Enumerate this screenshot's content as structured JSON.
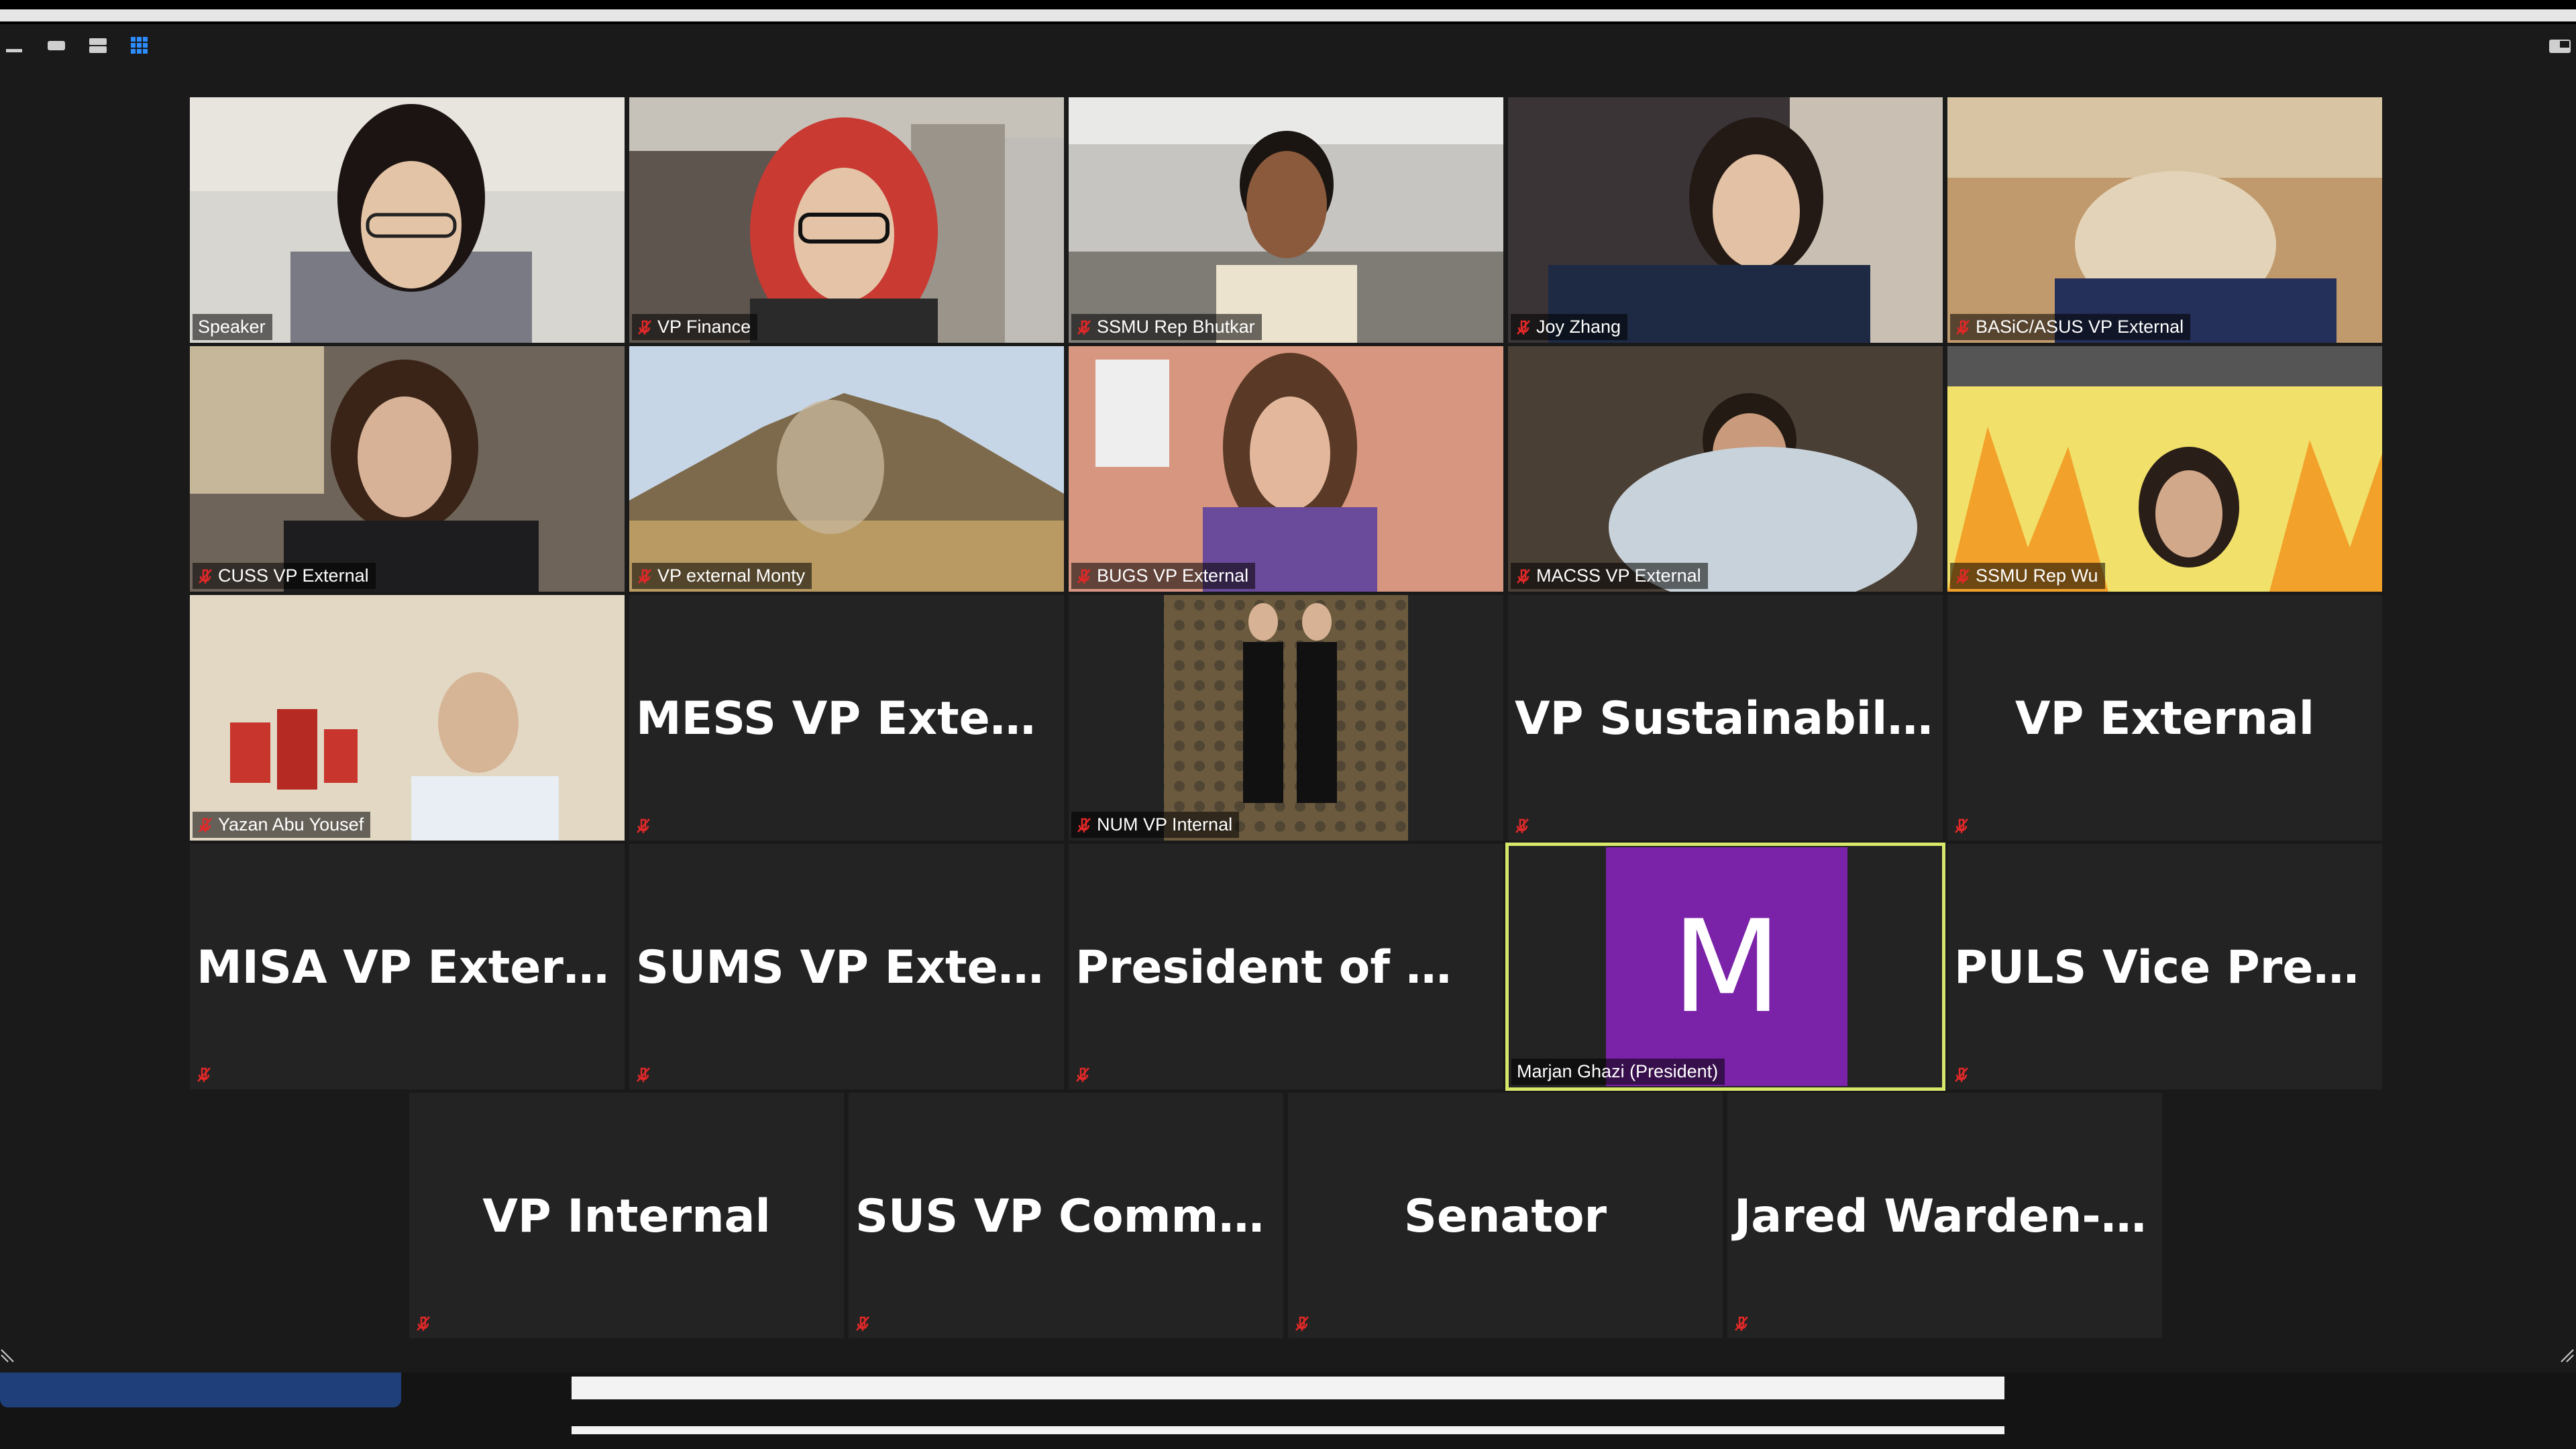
{
  "colors": {
    "accent_active": "#d7e86a",
    "tile_bg": "#232323",
    "avatar_bg": "#7a22a8",
    "mute_red": "#e02828"
  },
  "toolbar": {
    "minimize_icon": "minimize-icon",
    "speaker_view_icon": "speaker-view-icon",
    "strip_view_icon": "strip-view-icon",
    "gallery_view_icon": "gallery-view-icon",
    "exit_fullscreen_icon": "exit-fullscreen-icon"
  },
  "participants": [
    {
      "label": "Speaker",
      "muted": false,
      "type": "video"
    },
    {
      "label": "VP Finance",
      "muted": true,
      "type": "video"
    },
    {
      "label": "SSMU Rep Bhutkar",
      "muted": true,
      "type": "video"
    },
    {
      "label": "Joy Zhang",
      "muted": true,
      "type": "video"
    },
    {
      "label": "BASiC/ASUS VP External",
      "muted": true,
      "type": "video"
    },
    {
      "label": "CUSS VP External",
      "muted": true,
      "type": "video"
    },
    {
      "label": "VP external Monty",
      "muted": true,
      "type": "video"
    },
    {
      "label": "BUGS VP External",
      "muted": true,
      "type": "video"
    },
    {
      "label": "MACSS VP External",
      "muted": true,
      "type": "video"
    },
    {
      "label": "SSMU Rep Wu",
      "muted": true,
      "type": "video"
    },
    {
      "label": "Yazan Abu Yousef",
      "muted": true,
      "type": "video"
    },
    {
      "name": "MESS VP External",
      "muted": true,
      "type": "name"
    },
    {
      "label": "NUM VP Internal",
      "muted": true,
      "type": "photo"
    },
    {
      "name": "VP Sustainability",
      "muted": true,
      "type": "name"
    },
    {
      "name": "VP External",
      "muted": true,
      "type": "name"
    },
    {
      "name": "MISA VP External",
      "muted": true,
      "type": "name"
    },
    {
      "name": "SUMS VP External",
      "muted": true,
      "type": "name"
    },
    {
      "name": "President of Mo...",
      "muted": true,
      "type": "name"
    },
    {
      "label": "Marjan Ghazi (President)",
      "avatar_letter": "M",
      "muted": false,
      "type": "avatar",
      "active": true
    },
    {
      "name": "PULS Vice Presid...",
      "muted": true,
      "type": "name"
    },
    {
      "name": "VP Internal",
      "muted": true,
      "type": "name"
    },
    {
      "name": "SUS VP Commu...",
      "muted": true,
      "type": "name"
    },
    {
      "name": "Senator",
      "muted": true,
      "type": "name"
    },
    {
      "name": "Jared Warden-J...",
      "muted": true,
      "type": "name"
    }
  ]
}
